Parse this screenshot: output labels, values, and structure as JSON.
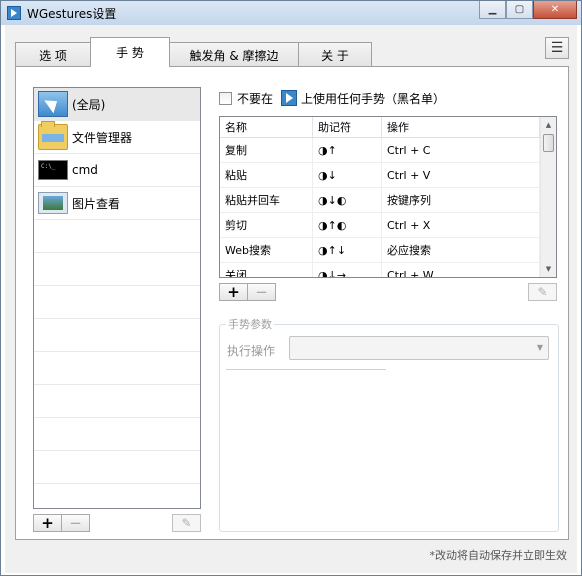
{
  "window": {
    "title": "WGestures设置",
    "controls": [
      "minimize",
      "maximize",
      "close"
    ]
  },
  "tabs": [
    {
      "label": "选 项",
      "active": false
    },
    {
      "label": "手 势",
      "active": true
    },
    {
      "label": "触发角 & 摩擦边",
      "active": false
    },
    {
      "label": "关 于",
      "active": false
    }
  ],
  "menu_icon": "hamburger-menu-icon",
  "apps": [
    {
      "label": "(全局)",
      "icon": "global-cursor-icon",
      "selected": true
    },
    {
      "label": "文件管理器",
      "icon": "folder-icon",
      "selected": false
    },
    {
      "label": "cmd",
      "icon": "cmd-icon",
      "selected": false
    },
    {
      "label": "图片查看",
      "icon": "photo-viewer-icon",
      "selected": false
    }
  ],
  "app_buttons": {
    "add": "+",
    "remove": "−",
    "edit_icon": "pencil-icon"
  },
  "blacklist": {
    "prefix": "不要在",
    "suffix": "上使用任何手势（黑名单）",
    "checked": false
  },
  "gestures": {
    "headers": [
      "名称",
      "助记符",
      "操作"
    ],
    "rows": [
      {
        "name": "复制",
        "mnemonic": "◑↑",
        "action": "Ctrl + C"
      },
      {
        "name": "粘贴",
        "mnemonic": "◑↓",
        "action": "Ctrl + V"
      },
      {
        "name": "粘贴并回车",
        "mnemonic": "◑↓◐",
        "action": "按键序列"
      },
      {
        "name": "剪切",
        "mnemonic": "◑↑◐",
        "action": "Ctrl + X"
      },
      {
        "name": "Web搜索",
        "mnemonic": "◑↑↓",
        "action": "必应搜索"
      },
      {
        "name": "关闭",
        "mnemonic": "◑↓→",
        "action": "Ctrl + W"
      }
    ]
  },
  "gesture_buttons": {
    "add": "+",
    "remove": "−",
    "edit_icon": "pencil-icon"
  },
  "params": {
    "legend": "手势参数",
    "exec_label": "执行操作",
    "exec_value": ""
  },
  "footer": "*改动将自动保存并立即生效"
}
